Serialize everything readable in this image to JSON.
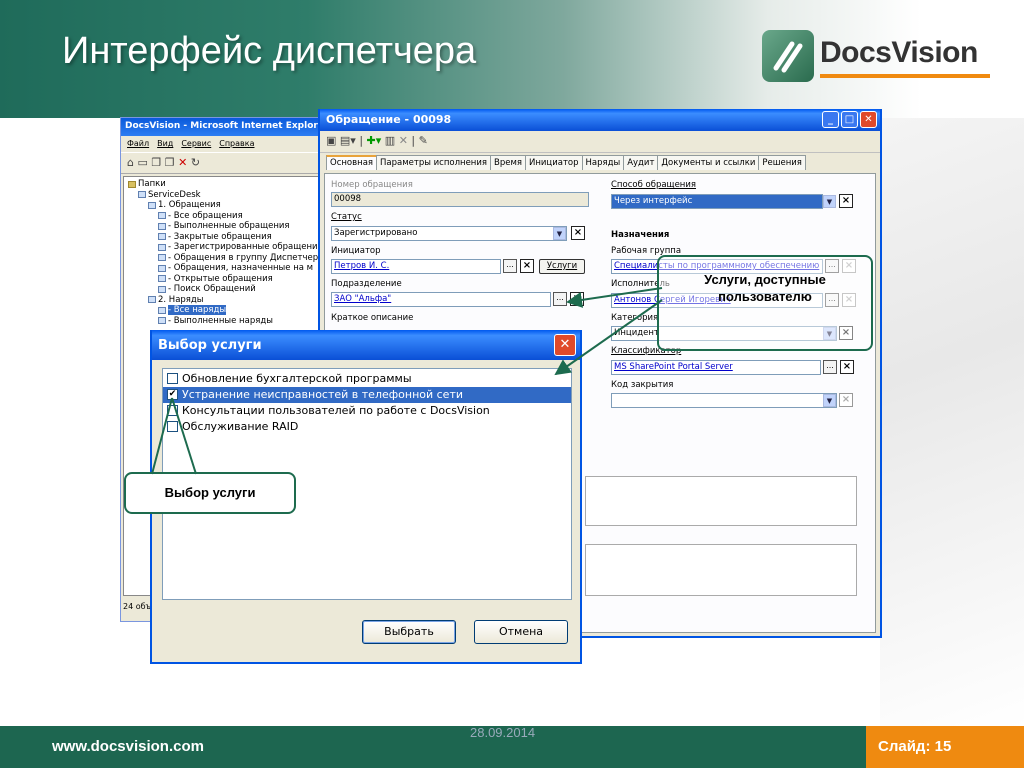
{
  "slide": {
    "title": "Интерфейс диспетчера",
    "logo_text": "DocsVision",
    "footer_url": "www.docsvision.com",
    "footer_date": "28.09.2014",
    "slide_number": "Слайд: 15",
    "colors": {
      "green": "#1d6650",
      "orange": "#ef8a10",
      "xp_blue": "#0054e3"
    }
  },
  "ie_window": {
    "title": "DocsVision - Microsoft Internet Explorer",
    "menu": [
      "Файл",
      "Вид",
      "Сервис",
      "Справка"
    ],
    "tree": [
      {
        "label": "Папки",
        "icon": "folder-icon",
        "indent": 0
      },
      {
        "label": "ServiceDesk",
        "icon": "globe-icon",
        "indent": 1
      },
      {
        "label": "1. Обращения",
        "icon": "page-icon",
        "indent": 2
      },
      {
        "label": "- Все обращения",
        "icon": "view-icon",
        "indent": 3
      },
      {
        "label": "- Выполненные обращения",
        "icon": "view-icon",
        "indent": 3
      },
      {
        "label": "- Закрытые обращения",
        "icon": "view-icon",
        "indent": 3
      },
      {
        "label": "- Зарегистрированные обращения",
        "icon": "view-icon",
        "indent": 3
      },
      {
        "label": "- Обращения в группу Диспетчер",
        "icon": "view-icon",
        "indent": 3
      },
      {
        "label": "- Обращения, назначенные на м",
        "icon": "view-icon",
        "indent": 3
      },
      {
        "label": "- Открытые обращения",
        "icon": "view-icon",
        "indent": 3
      },
      {
        "label": "- Поиск Обращений",
        "icon": "search-icon",
        "indent": 3
      },
      {
        "label": "2. Наряды",
        "icon": "page-icon",
        "indent": 2
      },
      {
        "label": "- Все наряды",
        "icon": "view-icon",
        "indent": 3,
        "selected": true
      },
      {
        "label": "- Выполненные наряды",
        "icon": "view-icon",
        "indent": 3
      }
    ],
    "status": "24 объ"
  },
  "request_window": {
    "title": "Обращение - 00098",
    "tabs": [
      "Основная",
      "Параметры исполнения",
      "Время",
      "Инициатор",
      "Наряды",
      "Аудит",
      "Документы и ссылки",
      "Решения"
    ],
    "active_tab": "Основная",
    "left": {
      "number_label": "Номер обращения",
      "number_value": "00098",
      "status_label": "Статус",
      "status_value": "Зарегистрировано",
      "initiator_label": "Инициатор",
      "initiator_value": "Петров И. С.",
      "services_button": "Услуги",
      "division_label": "Подразделение",
      "division_value": "ЗАО \"Альфа\"",
      "short_desc_label": "Краткое описание"
    },
    "right": {
      "method_label": "Способ обращения",
      "method_value": "Через интерфейс",
      "assignment_heading": "Назначения",
      "workgroup_label": "Рабочая группа",
      "workgroup_value": "Специалисты по программному обеспечению",
      "executor_label": "Исполнитель",
      "executor_value": "Антонов Сергей Игоревич",
      "category_label": "Категория",
      "category_value": "Инцидент",
      "classifier_label": "Классификатор",
      "classifier_value": "MS SharePoint Portal Server",
      "close_code_label": "Код закрытия",
      "close_code_value": ""
    }
  },
  "service_dialog": {
    "title": "Выбор услуги",
    "items": [
      {
        "label": "Обновление бухгалтерской программы",
        "checked": false,
        "selected": false
      },
      {
        "label": "Устранение неисправностей в телефонной сети",
        "checked": true,
        "selected": true
      },
      {
        "label": "Консультации пользователей по работе с DocsVision",
        "checked": false,
        "selected": false
      },
      {
        "label": "Обслуживание RAID",
        "checked": false,
        "selected": false
      }
    ],
    "ok_button": "Выбрать",
    "cancel_button": "Отмена"
  },
  "callouts": {
    "services_available": "Услуги, доступные пользователю",
    "service_choice": "Выбор услуги"
  }
}
